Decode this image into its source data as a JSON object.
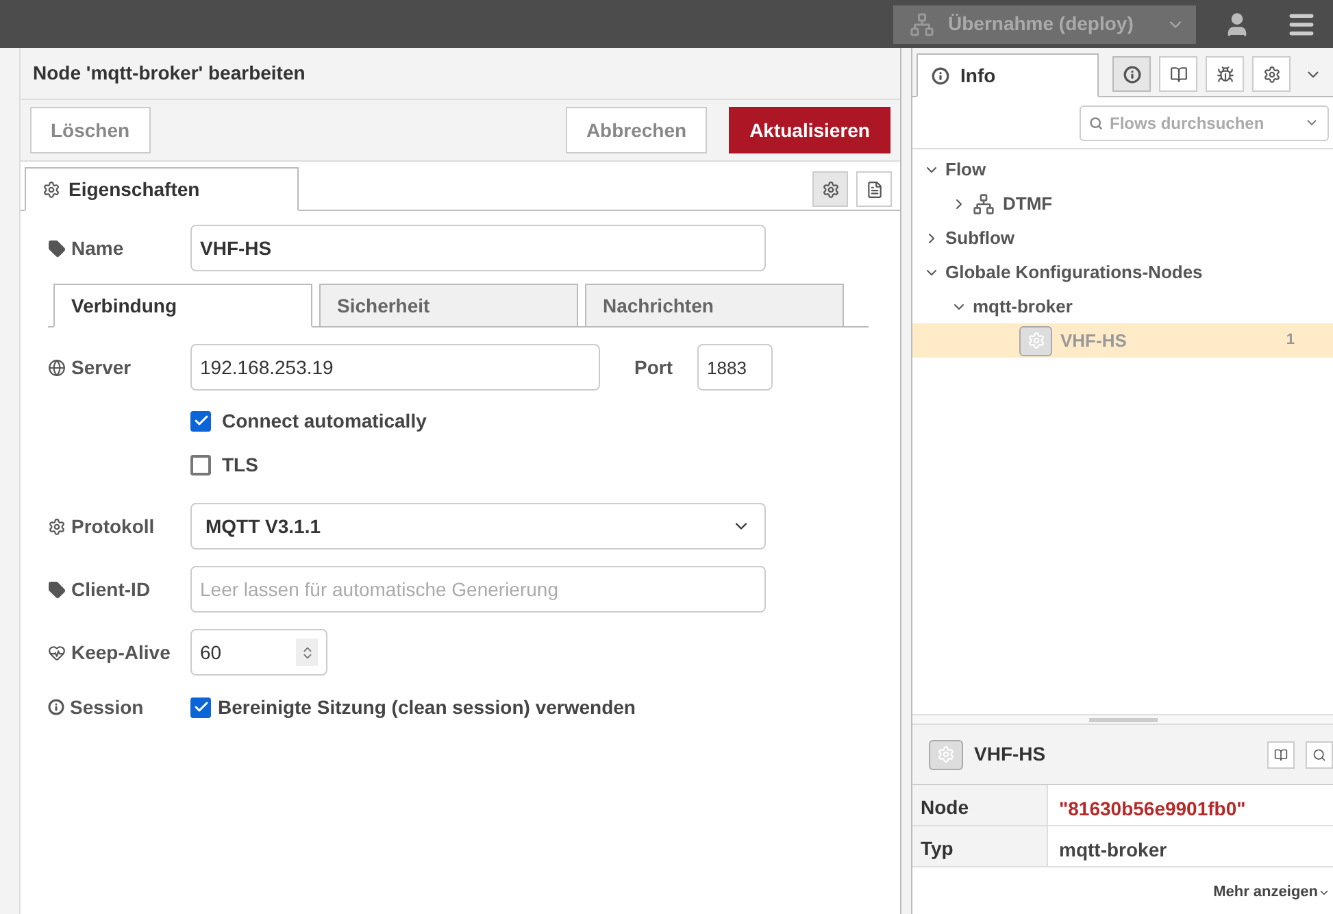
{
  "header": {
    "deploy_label": "Übernahme (deploy)"
  },
  "editor": {
    "title": "Node 'mqtt-broker' bearbeiten",
    "buttons": [
      {
        "label": "Löschen",
        "kind": "delete"
      },
      {
        "label": "Abbrechen",
        "kind": "secondary"
      },
      {
        "label": "Aktualisieren",
        "kind": "primary"
      }
    ],
    "tabs": [
      {
        "label": "Eigenschaften",
        "selected": true
      }
    ],
    "name": {
      "label": "Name",
      "value": "VHF-HS"
    },
    "sub_tabs": [
      {
        "label": "Verbindung",
        "selected": true
      },
      {
        "label": "Sicherheit",
        "selected": false
      },
      {
        "label": "Nachrichten",
        "selected": false
      }
    ],
    "server": {
      "label": "Server",
      "value": "192.168.253.19"
    },
    "port": {
      "label": "Port",
      "value": "1883"
    },
    "options": [
      {
        "label": "Connect automatically",
        "checked": true
      },
      {
        "label": "TLS",
        "checked": false
      }
    ],
    "protocol": {
      "label": "Protokoll",
      "value": "MQTT V3.1.1"
    },
    "client_id": {
      "label": "Client-ID",
      "placeholder": "Leer lassen für automatische Generierung"
    },
    "keep_alive": {
      "label": "Keep-Alive",
      "value": "60"
    },
    "session": {
      "label": "Session",
      "option": "Bereinigte Sitzung (clean session) verwenden",
      "checked": true
    }
  },
  "sidebar": {
    "tabs": [
      {
        "label": "Info",
        "selected": true
      }
    ],
    "search": {
      "placeholder": "Flows durchsuchen"
    },
    "tree": [
      {
        "label": "Flow",
        "expanded": true,
        "children": [
          {
            "label": "DTMF",
            "kind": "flow",
            "expanded": false
          }
        ]
      },
      {
        "label": "Subflow",
        "expanded": false
      },
      {
        "label": "Globale Konfigurations-Nodes",
        "expanded": true,
        "children": [
          {
            "label": "mqtt-broker",
            "expanded": true,
            "children": [
              {
                "label": "VHF-HS",
                "kind": "config-node",
                "count": "1",
                "selected": true
              }
            ]
          }
        ]
      }
    ],
    "info": {
      "title": "VHF-HS",
      "rows": [
        {
          "key": "Node",
          "value": "\"81630b56e9901fb0\"",
          "kind": "id"
        },
        {
          "key": "Typ",
          "value": "mqtt-broker",
          "kind": "text"
        }
      ],
      "more": "Mehr anzeigen"
    }
  }
}
